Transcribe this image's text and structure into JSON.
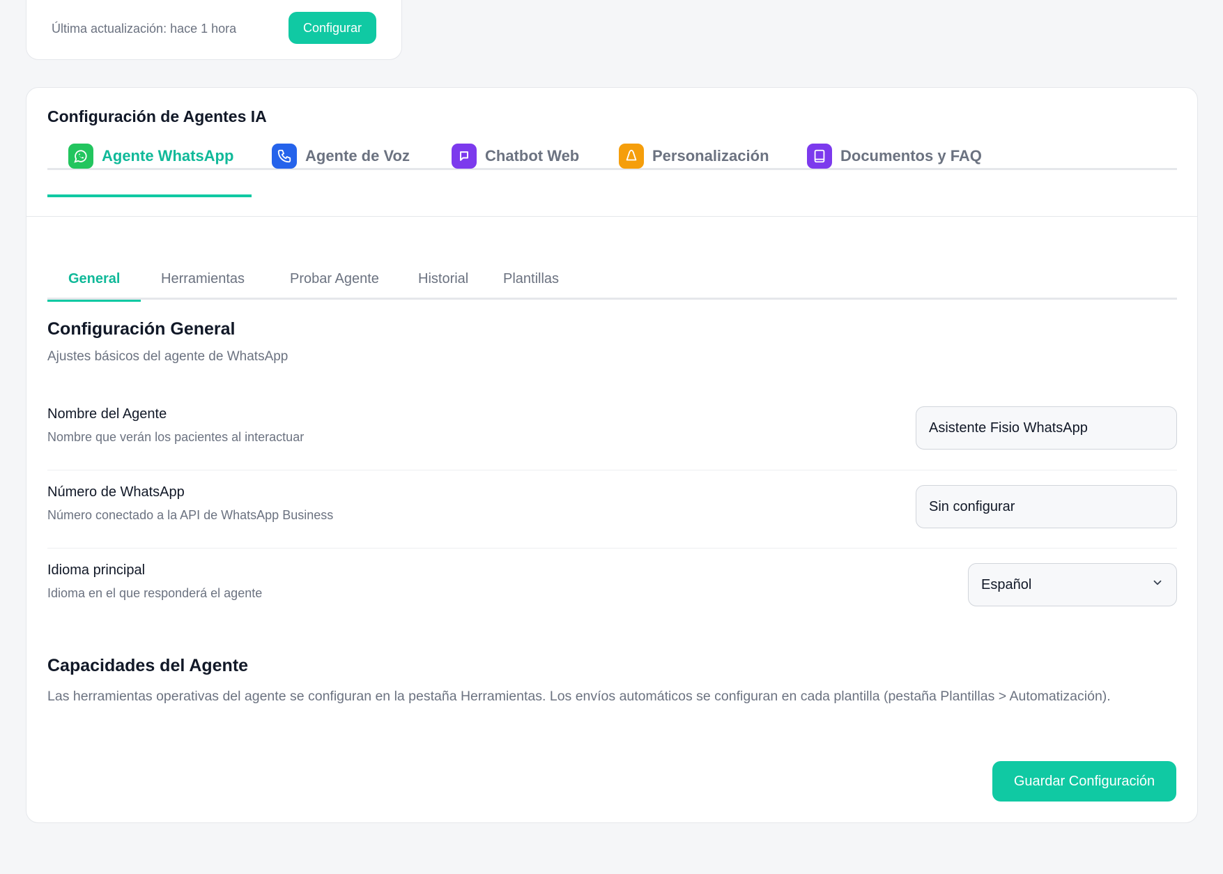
{
  "status_card": {
    "updated_text": "Última actualización: hace 1 hora",
    "configure_label": "Configurar"
  },
  "agents_card": {
    "title": "Configuración de Agentes IA",
    "agent_tabs": [
      {
        "label": "Agente WhatsApp",
        "icon": "whatsapp-icon",
        "color": "#22c55e",
        "active": true
      },
      {
        "label": "Agente de Voz",
        "icon": "phone-icon",
        "color": "#2563eb",
        "active": false
      },
      {
        "label": "Chatbot Web",
        "icon": "chat-bubble-icon",
        "color": "#7c3aed",
        "active": false
      },
      {
        "label": "Personalización",
        "icon": "bell-icon",
        "color": "#f59e0b",
        "active": false
      },
      {
        "label": "Documentos y FAQ",
        "icon": "book-icon",
        "color": "#7c3aed",
        "active": false
      }
    ],
    "sub_tabs": [
      {
        "label": "General",
        "active": true
      },
      {
        "label": "Herramientas",
        "active": false
      },
      {
        "label": "Probar Agente",
        "active": false
      },
      {
        "label": "Historial",
        "active": false
      },
      {
        "label": "Plantillas",
        "active": false
      }
    ]
  },
  "general": {
    "title": "Configuración General",
    "description": "Ajustes básicos del agente de WhatsApp",
    "fields": {
      "agent_name": {
        "label": "Nombre del Agente",
        "help": "Nombre que verán los pacientes al interactuar",
        "value": "Asistente Fisio WhatsApp"
      },
      "whatsapp_number": {
        "label": "Número de WhatsApp",
        "help": "Número conectado a la API de WhatsApp Business",
        "value": "Sin configurar"
      },
      "language": {
        "label": "Idioma principal",
        "help": "Idioma en el que responderá el agente",
        "value": "Español"
      }
    }
  },
  "capabilities": {
    "title": "Capacidades del Agente",
    "text": "Las herramientas operativas del agente se configuran en la pestaña Herramientas. Los envíos automáticos se configuran en cada plantilla (pestaña Plantillas > Automatización)."
  },
  "save_label": "Guardar Configuración",
  "colors": {
    "accent": "#10c9a3",
    "accent_text": "#10b999"
  }
}
